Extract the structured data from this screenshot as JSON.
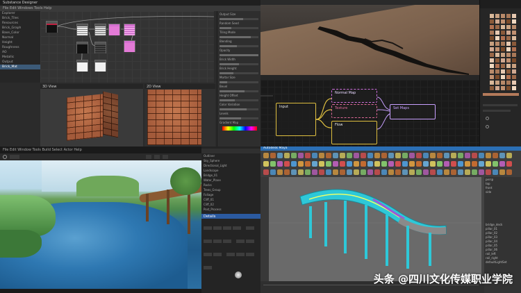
{
  "substance_designer": {
    "title": "Substance Designer",
    "menu": "File  Edit  Windows  Tools  Help",
    "explorer_items": [
      "Explorer",
      "Brick_Tiles",
      "Resources",
      "Brick_Graph",
      "Base_Color",
      "Normal",
      "Height",
      "Roughness",
      "AO",
      "Metallic",
      "Output",
      "Brick_Mat"
    ],
    "explorer_selected_index": 11,
    "properties": [
      "Output Size",
      "Random Seed",
      "Tiling Mode",
      "Blending",
      "Opacity",
      "Brick Width",
      "Brick Height",
      "Mortar Size",
      "Bevel",
      "Height Offset",
      "Color Variation",
      "Levels",
      "Gradient Map"
    ],
    "view3d_label": "3D View",
    "view2d_label": "2D View",
    "colors": {
      "bg": "#2b2b2b",
      "node_pink": "#e37ad6",
      "node_dark": "#1a1a1a",
      "brick": "#a35a3a"
    }
  },
  "unreal_blueprint": {
    "nodes": {
      "input": "Input",
      "normal_map": "Normal Map",
      "texture": "Texture",
      "flow": "Flow",
      "output": "Set Maps"
    },
    "colors": {
      "input": "#e0c040",
      "normal_map": "#d070e0",
      "texture": "#e06a9a",
      "flow": "#e0c040",
      "output": "#c8a0ff",
      "terrain": "#8a6f58"
    },
    "swatch_colors": [
      "#d9b89a",
      "#c8a080",
      "#b88a6a",
      "#a87858",
      "#e6c8b0",
      "#8a5a3a",
      "#d0a890",
      "#c09070",
      "#7a4a2a",
      "#f0d8c0",
      "#b07050",
      "#9a6848"
    ]
  },
  "game_viewport": {
    "menu": "File  Edit  Window  Tools  Build  Select  Actor  Help",
    "outliner_items": [
      "Outliner",
      "Sky_Sphere",
      "Directional_Light",
      "Landscape",
      "Bridge_01",
      "Water_Plane",
      "Rocks",
      "Trees_Group",
      "Foliage",
      "Cliff_01",
      "Cliff_02",
      "Post_Process"
    ],
    "details_label": "Details",
    "colors": {
      "water": "#2e78b2",
      "grass": "#4d8a4c",
      "bridge": "#8a5a32"
    }
  },
  "maya": {
    "title": "Autodesk Maya",
    "outliner_items": [
      "persp",
      "top",
      "front",
      "side",
      "bridge_deck",
      "pillar_01",
      "pillar_02",
      "pillar_03",
      "pillar_04",
      "pillar_05",
      "pillar_06",
      "rail_left",
      "rail_right",
      "defaultLightSet"
    ],
    "colors": {
      "viewport": "#6a6a6a",
      "wire": "#2ec8d8",
      "deck_highlight": "#9a5ad8"
    }
  },
  "watermark": "头条 @四川文化传媒职业学院"
}
